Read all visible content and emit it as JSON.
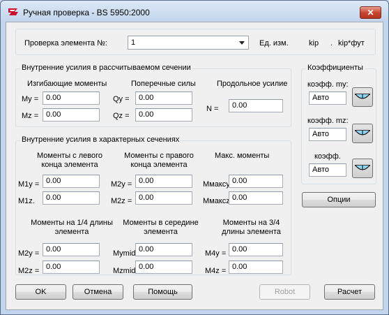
{
  "window": {
    "title": "Ручная проверка - BS 5950:2000",
    "close_label": "✕"
  },
  "top": {
    "element_label": "Проверка элемента №:",
    "element_value": "1",
    "units_label": "Ед. изм.",
    "unit_force": "kip",
    "unit_moment": "kip*фут"
  },
  "internal": {
    "title": "Внутренние усилия в рассчитываемом сечении",
    "bending_header": "Изгибающие моменты",
    "shear_header": "Поперечные силы",
    "axial_header": "Продольное усилие",
    "my_label": "My =",
    "my_value": "0.00",
    "mz_label": "Mz =",
    "mz_value": "0.00",
    "qy_label": "Qy =",
    "qy_value": "0.00",
    "qz_label": "Qz =",
    "qz_value": "0.00",
    "n_label": "N =",
    "n_value": "0.00"
  },
  "characteristic": {
    "title": "Внутренние усилия в характерных сечениях",
    "left_header": "Моменты с левого конца элемента",
    "right_header": "Моменты с правого конца элемента",
    "max_header": "Макс. моменты",
    "m1y_label": "M1y =",
    "m1y_value": "0.00",
    "m1z_label": "M1z.",
    "m1z_value": "0.00",
    "m2y_label": "M2y =",
    "m2y_value": "0.00",
    "m2z_label": "M2z =",
    "m2z_value": "0.00",
    "mmaxy_label": "Mмаксy",
    "mmaxy_value": "0.00",
    "mmaxz_label": "Mмаксz",
    "mmaxz_value": "0.00",
    "quarter_header": "Моменты на 1/4 длины элемента",
    "mid_header": "Моменты в середине элемента",
    "three_quarter_header": "Моменты на 3/4 длины элемента",
    "q_m2y_label": "M2y =",
    "q_m2y_value": "0.00",
    "q_m2z_label": "M2z =",
    "q_m2z_value": "0.00",
    "mymid_label": "Mymid",
    "mymid_value": "0.00",
    "mzmid_label": "Mzmid",
    "mzmid_value": "0.00",
    "m4y_label": "M4y =",
    "m4y_value": "0.00",
    "m4z_label": "M4z =",
    "m4z_value": "0.00"
  },
  "coefficients": {
    "title": "Коэффициенты",
    "my_label": "коэфф. my:",
    "my_value": "Авто",
    "mz_label": "коэфф. mz:",
    "mz_value": "Авто",
    "third_label": "коэфф.",
    "third_value": "Авто",
    "options_button": "Опции"
  },
  "buttons": {
    "ok": "OK",
    "cancel": "Отмена",
    "help": "Помощь",
    "robot": "Robot",
    "calculate": "Расчет"
  },
  "colors": {
    "client_bg": "#f0f0f0",
    "title_bar": "#c3d5ec",
    "close_button": "#c7462f"
  }
}
